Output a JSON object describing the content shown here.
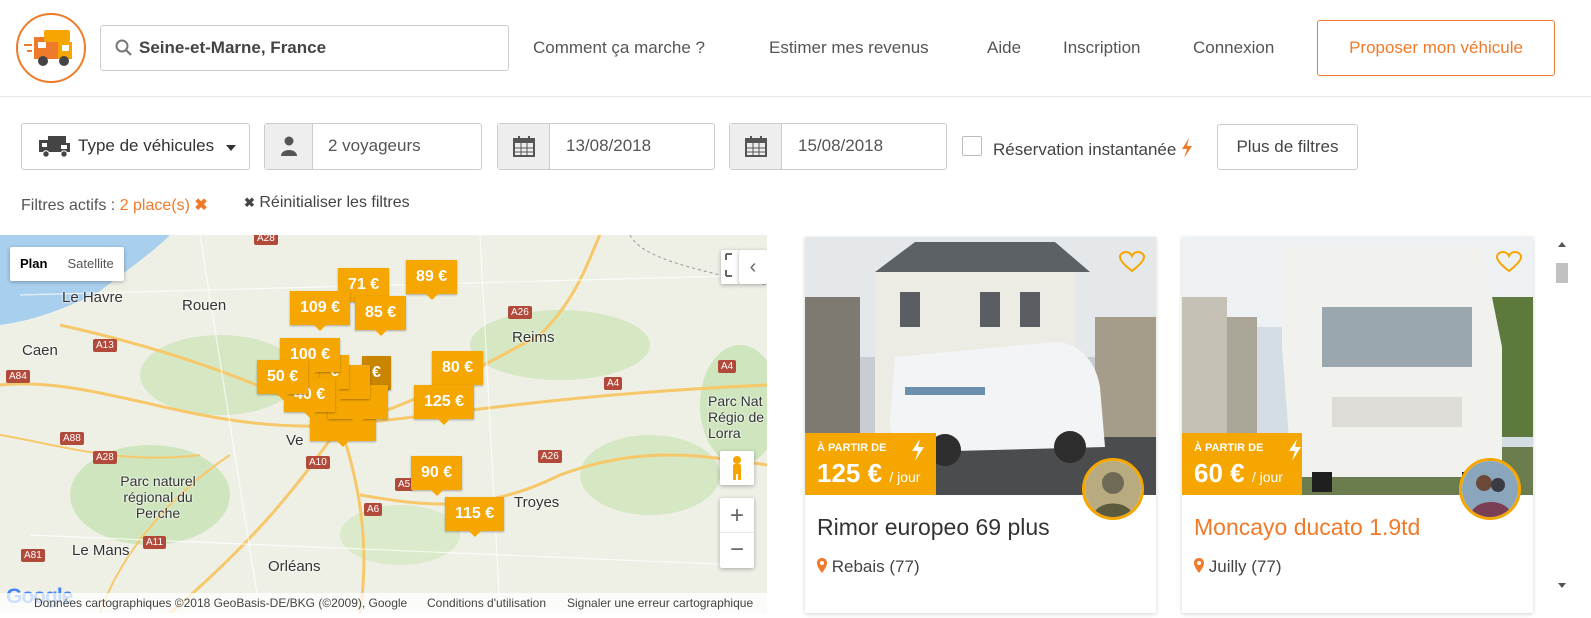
{
  "header": {
    "search_value": "Seine-et-Marne, France",
    "nav": [
      "Comment ça marche ?",
      "Estimer mes revenus",
      "Aide",
      "Inscription",
      "Connexion"
    ],
    "cta_label": "Proposer mon véhicule"
  },
  "filters": {
    "vehicle_type": "Type de véhicules",
    "travellers": "2 voyageurs",
    "date_start": "13/08/2018",
    "date_end": "15/08/2018",
    "instant_label": "Réservation instantanée",
    "instant_checked": false,
    "more_label": "Plus de filtres",
    "active_label": "Filtres actifs :",
    "active_tag": "2 place(s)",
    "reset_label": "Réinitialiser les filtres"
  },
  "map": {
    "map_type_options": [
      "Plan",
      "Satellite"
    ],
    "map_type_selected": "Plan",
    "cities": [
      "Le Havre",
      "Rouen",
      "Caen",
      "Reims",
      "Parc naturel régional du Perche",
      "Le Mans",
      "Orléans",
      "Troyes",
      "Parc Nat Régio de Lorra",
      "Ve"
    ],
    "roads": [
      "A28",
      "A26",
      "A13",
      "A84",
      "A4",
      "A88",
      "A28",
      "A10",
      "A26",
      "A5",
      "A6",
      "A11",
      "A81",
      "A4"
    ],
    "price_pins": [
      "71 €",
      "89 €",
      "109 €",
      "85 €",
      "100 €",
      "50 €",
      "€",
      "80 €",
      "40 €",
      "125 €",
      "90 €",
      "115 €",
      "€"
    ],
    "attribution": "Données cartographiques ©2018 GeoBasis-DE/BKG (©2009), Google",
    "terms": "Conditions d'utilisation",
    "report": "Signaler une erreur cartographique",
    "google_logo": "Google"
  },
  "listings": [
    {
      "from_label": "À PARTIR DE",
      "price": "125 €",
      "unit": "/ jour",
      "instant": true,
      "title": "Rimor europeo 69 plus",
      "location": "Rebais (77)"
    },
    {
      "from_label": "À PARTIR DE",
      "price": "60 €",
      "unit": "/ jour",
      "instant": true,
      "title": "Moncayo ducato 1.9td",
      "location": "Juilly (77)"
    }
  ],
  "colors": {
    "accent": "#f07a2b",
    "pin": "#f5a600"
  }
}
